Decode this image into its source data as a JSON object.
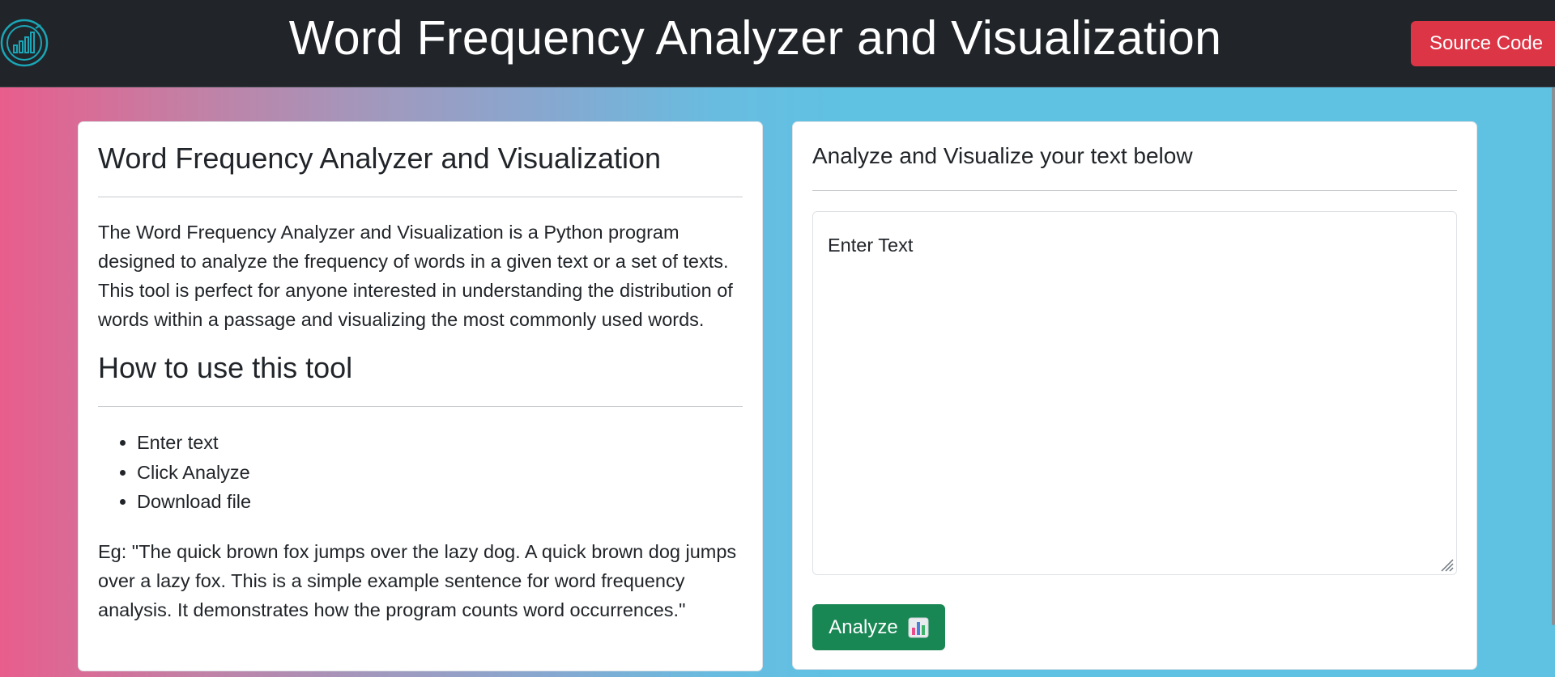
{
  "header": {
    "title": "Word Frequency Analyzer and Visualization",
    "source_button": "Source Code",
    "logo_icon": "bar-chart-circle-icon"
  },
  "left_card": {
    "title": "Word Frequency Analyzer and Visualization",
    "description": "The Word Frequency Analyzer and Visualization is a Python program designed to analyze the frequency of words in a given text or a set of texts. This tool is perfect for anyone interested in understanding the distribution of words within a passage and visualizing the most commonly used words.",
    "howto_title": "How to use this tool",
    "steps": [
      "Enter text",
      "Click Analyze",
      "Download file"
    ],
    "example": "Eg: \"The quick brown fox jumps over the lazy dog. A quick brown dog jumps over a lazy fox. This is a simple example sentence for word frequency analysis. It demonstrates how the program counts word occurrences.\""
  },
  "right_card": {
    "title": "Analyze and Visualize your text below",
    "textarea_placeholder": "Enter Text",
    "analyze_button": "Analyze",
    "analyze_icon": "bar-chart-emoji-icon"
  },
  "colors": {
    "navbar": "#212529",
    "source_button": "#dc3545",
    "analyze_button": "#198754",
    "logo_accent": "#1aa6b7",
    "gradient_left": "#e85d8c",
    "gradient_right": "#5fc2e3"
  }
}
